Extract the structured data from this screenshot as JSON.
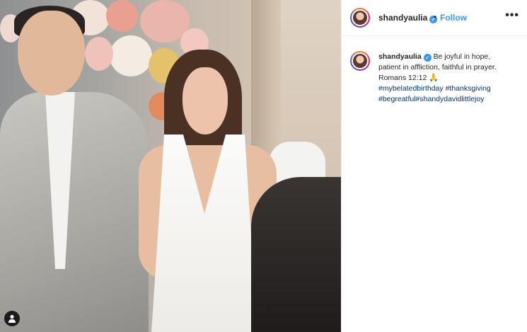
{
  "post": {
    "username": "shandyaulia",
    "verified_icon": "verified-badge-icon",
    "dot": "•",
    "follow_label": "Follow",
    "more_label": "•••",
    "caption": {
      "text_line1": "Be joyful in hope,",
      "text_line2": "patient in affliction, faithful in prayer.",
      "text_line3": "Romans 12:12",
      "emoji": "🙏",
      "hashtags": [
        "#mybelatedbirthday",
        "#thanksgiving",
        "#begreatful",
        "#shandydavidlittlejoy"
      ]
    }
  },
  "colors": {
    "accent": "#3897f0",
    "hashtag": "#003569",
    "text": "#262626",
    "border": "#efefef"
  }
}
